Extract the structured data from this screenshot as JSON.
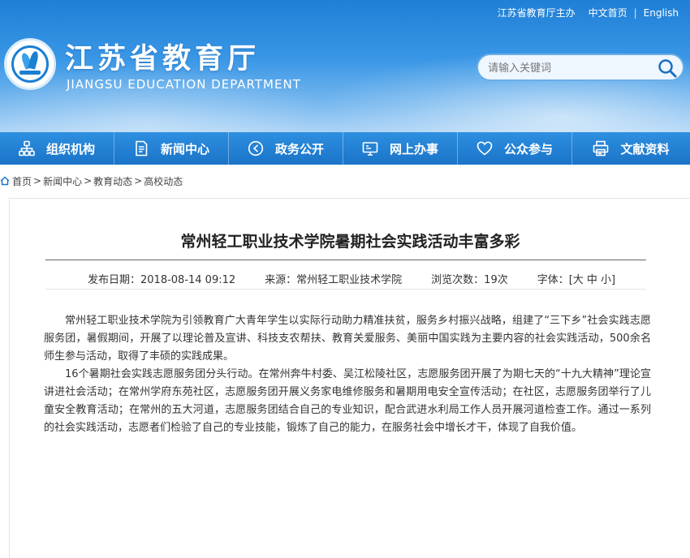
{
  "header": {
    "top_links": {
      "host": "江苏省教育厅主办",
      "chinese": "中文首页",
      "separator": "|",
      "english": "English"
    },
    "title": "江苏省教育厅",
    "subtitle": "JIANGSU EDUCATION DEPARTMENT",
    "search": {
      "placeholder": "请输入关键词"
    }
  },
  "nav": {
    "items": [
      {
        "label": "组织机构",
        "icon": "org-chart-icon"
      },
      {
        "label": "新闻中心",
        "icon": "document-icon"
      },
      {
        "label": "政务公开",
        "icon": "megaphone-icon"
      },
      {
        "label": "网上办事",
        "icon": "monitor-icon"
      },
      {
        "label": "公众参与",
        "icon": "heart-icon"
      },
      {
        "label": "文献资料",
        "icon": "printer-icon"
      }
    ]
  },
  "breadcrumb": {
    "items": [
      "首页",
      "新闻中心",
      "教育动态",
      "高校动态"
    ],
    "separator": ">"
  },
  "article": {
    "title": "常州轻工职业技术学院暑期社会实践活动丰富多彩",
    "meta": {
      "publish_date": "发布日期：2018-08-14 09:12",
      "source": "来源：常州轻工职业技术学院",
      "views": "浏览次数：19次",
      "font_size": "字体：[大 中 小]"
    },
    "paragraphs": [
      "常州轻工职业技术学院为引领教育广大青年学生以实际行动助力精准扶贫，服务乡村振兴战略，组建了“三下乡”社会实践志愿服务团，暑假期间，开展了以理论普及宣讲、科技支农帮扶、教育关爱服务、美丽中国实践为主要内容的社会实践活动，500余名师生参与活动，取得了丰硕的实践成果。",
      "16个暑期社会实践志愿服务团分头行动。在常州奔牛村委、吴江松陵社区，志愿服务团开展了为期七天的“十九大精神”理论宣讲进社会活动；在常州学府东苑社区，志愿服务团开展义务家电维修服务和暑期用电安全宣传活动；在社区，志愿服务团举行了儿童安全教育活动；在常州的五大河道，志愿服务团结合自己的专业知识，配合武进水利局工作人员开展河道检查工作。通过一系列的社会实践活动，志愿者们检验了自己的专业技能，锻炼了自己的能力，在服务社会中增长才干，体现了自我价值。"
    ]
  }
}
